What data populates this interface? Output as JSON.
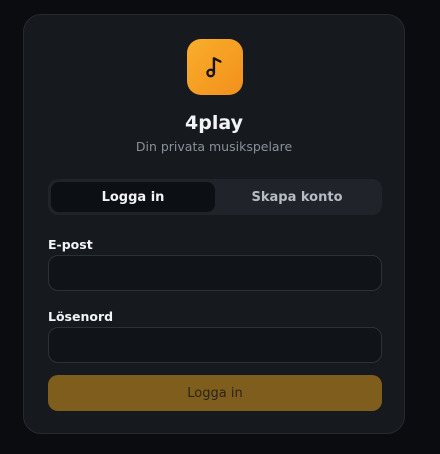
{
  "brand": {
    "name": "4play",
    "tagline": "Din privata musikspelare",
    "logo_icon": "music-note-icon",
    "accent": "#f5a020"
  },
  "tabs": [
    {
      "label": "Logga in",
      "active": true
    },
    {
      "label": "Skapa konto",
      "active": false
    }
  ],
  "form": {
    "email_label": "E-post",
    "email_value": "",
    "password_label": "Lösenord",
    "password_value": "",
    "submit_label": "Logga in",
    "submit_color": "#7f5e1d"
  }
}
